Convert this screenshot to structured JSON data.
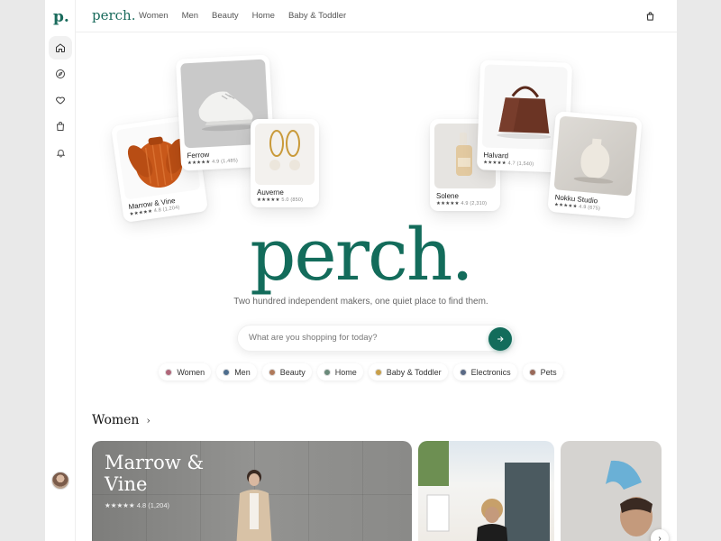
{
  "rail": {
    "logo": "p.",
    "items": [
      "home",
      "explore",
      "favorites",
      "bag",
      "notifications"
    ]
  },
  "nav": {
    "brand": "perch",
    "brand_dot": ".",
    "links": [
      "Women",
      "Men",
      "Beauty",
      "Home",
      "Baby & Toddler"
    ]
  },
  "hero_cards": [
    {
      "name": "Marrow & Vine",
      "rating": "4.8 (1,204)"
    },
    {
      "name": "Ferrow",
      "rating": "4.9 (1,485)"
    },
    {
      "name": "Auverne",
      "rating": "5.0 (850)"
    },
    {
      "name": "Solene",
      "rating": "4.9 (2,310)"
    },
    {
      "name": "Halvard",
      "rating": "4.7 (1,540)"
    },
    {
      "name": "Nokku Studio",
      "rating": "4.9 (675)"
    }
  ],
  "stars": "★★★★★",
  "hero": {
    "title": "perch.",
    "tagline": "Two hundred independent makers, one quiet place to find them."
  },
  "search": {
    "placeholder": "What are you shopping for today?",
    "value": ""
  },
  "chips": [
    {
      "label": "Women",
      "color": "#b0677a"
    },
    {
      "label": "Men",
      "color": "#4e6e8e"
    },
    {
      "label": "Beauty",
      "color": "#b07a5b"
    },
    {
      "label": "Home",
      "color": "#6a8a7a"
    },
    {
      "label": "Baby & Toddler",
      "color": "#c9a04a"
    },
    {
      "label": "Electronics",
      "color": "#5a6a86"
    },
    {
      "label": "Pets",
      "color": "#9a6a5a"
    }
  ],
  "section": {
    "title": "Women",
    "feature_brand": "Marrow & Vine",
    "feature_rating": "4.8 (1,204)"
  },
  "colors": {
    "accent": "#136c5b"
  }
}
